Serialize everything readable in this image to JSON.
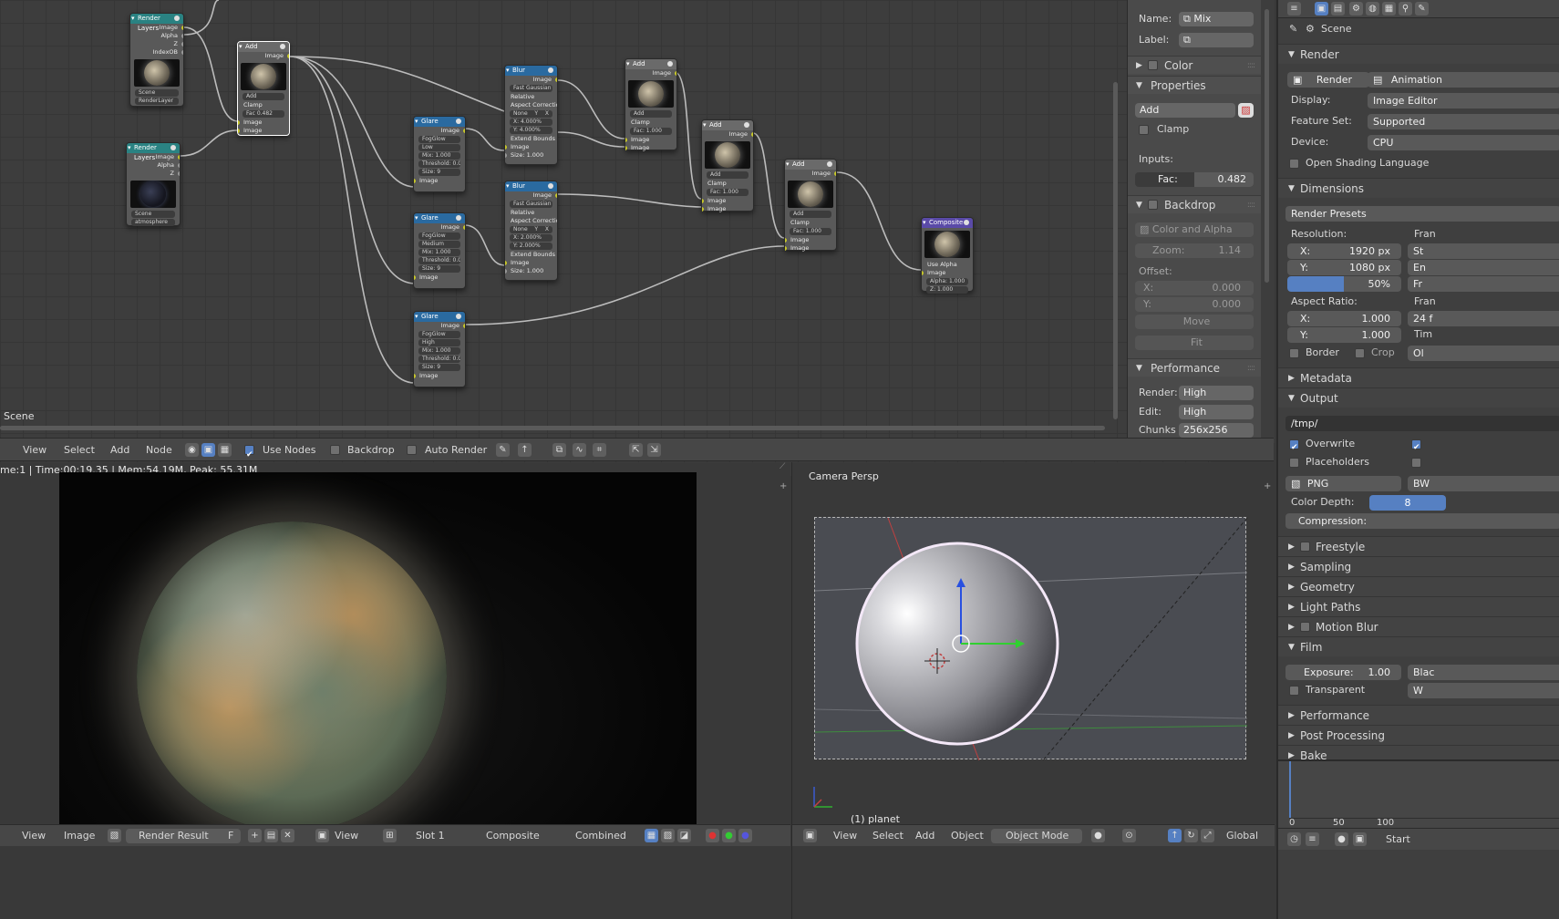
{
  "node_editor": {
    "scene_label": "Scene",
    "nodes": {
      "render_layers_1": {
        "title": "Render Layers",
        "outputs": [
          "Image",
          "Alpha",
          "Z",
          "IndexOB"
        ],
        "scene": "Scene",
        "layer": "RenderLayer"
      },
      "render_layers_2": {
        "title": "Render Layers",
        "outputs": [
          "Image",
          "Alpha",
          "Z"
        ],
        "scene": "Scene",
        "layer": "atmosphere"
      },
      "add_1": {
        "title": "Add",
        "output": "Image",
        "mode": "Add",
        "clamp": "Clamp",
        "fac_label": "Fac",
        "fac": "0.482",
        "inputs": [
          "Image",
          "Image"
        ]
      },
      "glare_1": {
        "title": "Glare",
        "output": "Image",
        "type": "FogGlow",
        "quality": "Low",
        "mix": "Mix: 1.000",
        "threshold": "Threshold: 0.000",
        "size": "Size: 9",
        "input": "Image"
      },
      "glare_2": {
        "title": "Glare",
        "output": "Image",
        "type": "FogGlow",
        "quality": "Medium",
        "mix": "Mix: 1.000",
        "threshold": "Threshold: 0.000",
        "size": "Size: 9",
        "input": "Image"
      },
      "glare_3": {
        "title": "Glare",
        "output": "Image",
        "type": "FogGlow",
        "quality": "High",
        "mix": "Mix: 1.000",
        "threshold": "Threshold: 0.000",
        "size": "Size: 9",
        "input": "Image"
      },
      "blur_1": {
        "title": "Blur",
        "output": "Image",
        "filter": "Fast Gaussian",
        "relative": "Relative",
        "aspect": "Aspect Correction",
        "aspect_opts": [
          "None",
          "Y",
          "X"
        ],
        "x": "X: 4.000%",
        "y": "Y: 4.000%",
        "extend": "Extend Bounds",
        "in_image": "Image",
        "in_size": "Size: 1.000"
      },
      "blur_2": {
        "title": "Blur",
        "output": "Image",
        "filter": "Fast Gaussian",
        "relative": "Relative",
        "aspect": "Aspect Correction",
        "aspect_opts": [
          "None",
          "Y",
          "X"
        ],
        "x": "X: 2.000%",
        "y": "Y: 2.000%",
        "extend": "Extend Bounds",
        "in_image": "Image",
        "in_size": "Size: 1.000"
      },
      "add_2": {
        "title": "Add",
        "output": "Image",
        "mode": "Add",
        "clamp": "Clamp",
        "fac": "Fac: 1.000",
        "inputs": [
          "Image",
          "Image"
        ]
      },
      "add_3": {
        "title": "Add",
        "output": "Image",
        "mode": "Add",
        "clamp": "Clamp",
        "fac": "Fac: 1.000",
        "inputs": [
          "Image",
          "Image"
        ]
      },
      "add_4": {
        "title": "Add",
        "output": "Image",
        "mode": "Add",
        "clamp": "Clamp",
        "fac": "Fac: 1.000",
        "inputs": [
          "Image",
          "Image"
        ]
      },
      "composite": {
        "title": "Composite",
        "use_alpha": "Use Alpha",
        "inputs": [
          "Image",
          "Alpha: 1.000",
          "Z: 1.000"
        ]
      }
    }
  },
  "npanel": {
    "name_label": "Name:",
    "name_value": "Mix",
    "label_label": "Label:",
    "label_value": "",
    "color": "Color",
    "properties": "Properties",
    "blend_mode": "Add",
    "clamp": "Clamp",
    "inputs_label": "Inputs:",
    "fac_label": "Fac:",
    "fac_value": "0.482",
    "backdrop": "Backdrop",
    "color_alpha": "Color and Alpha",
    "zoom_label": "Zoom:",
    "zoom_value": "1.14",
    "offset_label": "Offset:",
    "offset_x_label": "X:",
    "offset_x": "0.000",
    "offset_y_label": "Y:",
    "offset_y": "0.000",
    "move": "Move",
    "fit": "Fit",
    "performance": "Performance",
    "render_label": "Render:",
    "render_value": "High",
    "edit_label": "Edit:",
    "edit_value": "High",
    "chunks_label": "Chunks",
    "chunks_value": "256x256"
  },
  "ne_header": {
    "menus": [
      "View",
      "Select",
      "Add",
      "Node"
    ],
    "use_nodes": "Use Nodes",
    "backdrop": "Backdrop",
    "auto_render": "Auto Render"
  },
  "image_editor": {
    "info": "me:1 | Time:00:19.35 | Mem:54.19M, Peak: 55.31M",
    "menus": [
      "View",
      "Image"
    ],
    "image_name": "Render Result",
    "image_users": "F",
    "view_menu": "View",
    "slot": "Slot 1",
    "layer": "Composite",
    "pass": "Combined"
  },
  "view3d": {
    "view_label": "Camera Persp",
    "object_label": "(1) planet",
    "menus": [
      "View",
      "Select",
      "Add",
      "Object"
    ],
    "mode": "Object Mode",
    "global": "Global"
  },
  "props": {
    "scene": "Scene",
    "render": "Render",
    "render_btn": "Render",
    "animation_btn": "Animation",
    "display_label": "Display:",
    "display_value": "Image Editor",
    "feature_label": "Feature Set:",
    "feature_value": "Supported",
    "device_label": "Device:",
    "device_value": "CPU",
    "osl": "Open Shading Language",
    "dimensions": "Dimensions",
    "presets": "Render Presets",
    "resolution_label": "Resolution:",
    "res_x_label": "X:",
    "res_x": "1920 px",
    "res_y_label": "Y:",
    "res_y": "1080 px",
    "res_pct": "50%",
    "aspect_label": "Aspect Ratio:",
    "asp_x_label": "X:",
    "asp_x": "1.000",
    "asp_y_label": "Y:",
    "asp_y": "1.000",
    "border": "Border",
    "crop": "Crop",
    "frame_cut_1": "Fran",
    "frame_cut_2": "St",
    "frame_cut_3": "En",
    "frame_cut_4": "Fr",
    "frame_cut_5": "Fran",
    "frame_cut_6": "24 f",
    "frame_cut_7": "Tim",
    "frame_cut_8": "Ol",
    "metadata": "Metadata",
    "output": "Output",
    "output_path": "/tmp/",
    "overwrite": "Overwrite",
    "placeholders": "Placeholders",
    "format": "PNG",
    "color_mode": "BW",
    "depth_label": "Color Depth:",
    "depth_value": "8",
    "compression": "Compression:",
    "freestyle": "Freestyle",
    "sampling": "Sampling",
    "geometry": "Geometry",
    "light_paths": "Light Paths",
    "motion_blur": "Motion Blur",
    "film": "Film",
    "exposure_label": "Exposure:",
    "exposure_value": "1.00",
    "blac_cut": "Blac",
    "w_cut": "W",
    "transparent": "Transparent",
    "performance": "Performance",
    "post_processing": "Post Processing",
    "bake": "Bake",
    "timeline_ticks": [
      "0",
      "50",
      "100"
    ],
    "start_cut": "Start"
  }
}
